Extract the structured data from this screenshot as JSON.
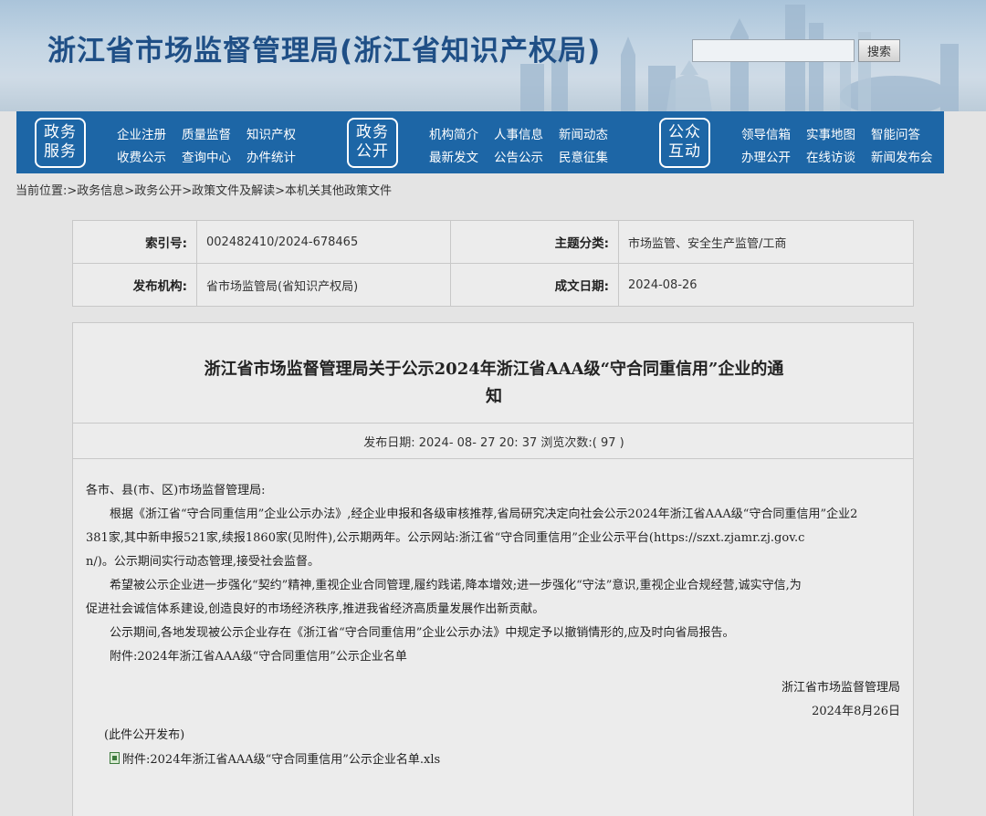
{
  "header": {
    "site_title": "浙江省市场监督管理局(浙江省知识产权局)",
    "search": {
      "placeholder": "",
      "value": "",
      "button_label": "搜索"
    }
  },
  "nav": {
    "groups": [
      {
        "badge": [
          "政务",
          "服务"
        ],
        "links": [
          "企业注册",
          "质量监督",
          "知识产权",
          "收费公示",
          "查询中心",
          "办件统计"
        ]
      },
      {
        "badge": [
          "政务",
          "公开"
        ],
        "links": [
          "机构简介",
          "人事信息",
          "新闻动态",
          "最新发文",
          "公告公示",
          "民意征集"
        ]
      },
      {
        "badge": [
          "公众",
          "互动"
        ],
        "links": [
          "领导信箱",
          "实事地图",
          "智能问答",
          "办理公开",
          "在线访谈",
          "新闻发布会"
        ]
      }
    ]
  },
  "breadcrumb": {
    "prefix": "当前位置:",
    "items": [
      ">政务信息",
      ">政务公开",
      ">政策文件及解读",
      ">本机关其他政策文件"
    ]
  },
  "meta": {
    "index_label": "索引号:",
    "index_value": "002482410/2024-678465",
    "topic_label": "主题分类:",
    "topic_value": "市场监管、安全生产监管/工商",
    "publisher_label": "发布机构:",
    "publisher_value": "省市场监管局(省知识产权局)",
    "date_label": "成文日期:",
    "date_value": "2024-08-26"
  },
  "article": {
    "title_line1": "浙江省市场监督管理局关于公示2024年浙江省AAA级“守合同重信用”企业的通",
    "title_line2": "知",
    "pub_info": "发布日期: 2024- 08- 27 20: 37 浏览次数:( 97 )",
    "salutation": "各市、县(市、区)市场监督管理局:",
    "p1_l1": "根据《浙江省“守合同重信用”企业公示办法》,经企业申报和各级审核推荐,省局研究决定向社会公示2024年浙江省AAA级“守合同重信用”企业2",
    "p1_l2": "381家,其中新申报521家,续报1860家(见附件),公示期两年。公示网站:浙江省“守合同重信用”企业公示平台(https://szxt.zjamr.zj.gov.c",
    "p1_l3": "n/)。公示期间实行动态管理,接受社会监督。",
    "p2_l1": "希望被公示企业进一步强化“契约”精神,重视企业合同管理,履约践诺,降本增效;进一步强化“守法”意识,重视企业合规经营,诚实守信,为",
    "p2_l2": "促进社会诚信体系建设,创造良好的市场经济秩序,推进我省经济高质量发展作出新贡献。",
    "p3": "公示期间,各地发现被公示企业存在《浙江省“守合同重信用”企业公示办法》中规定予以撤销情形的,应及时向省局报告。",
    "attachment_line": "附件:2024年浙江省AAA级“守合同重信用”公示企业名单",
    "sign_org": "浙江省市场监督管理局",
    "sign_date": "2024年8月26日",
    "public_note": "(此件公开发布)",
    "attachment_link": "附件:2024年浙江省AAA级“守合同重信用”公示企业名单.xls"
  }
}
